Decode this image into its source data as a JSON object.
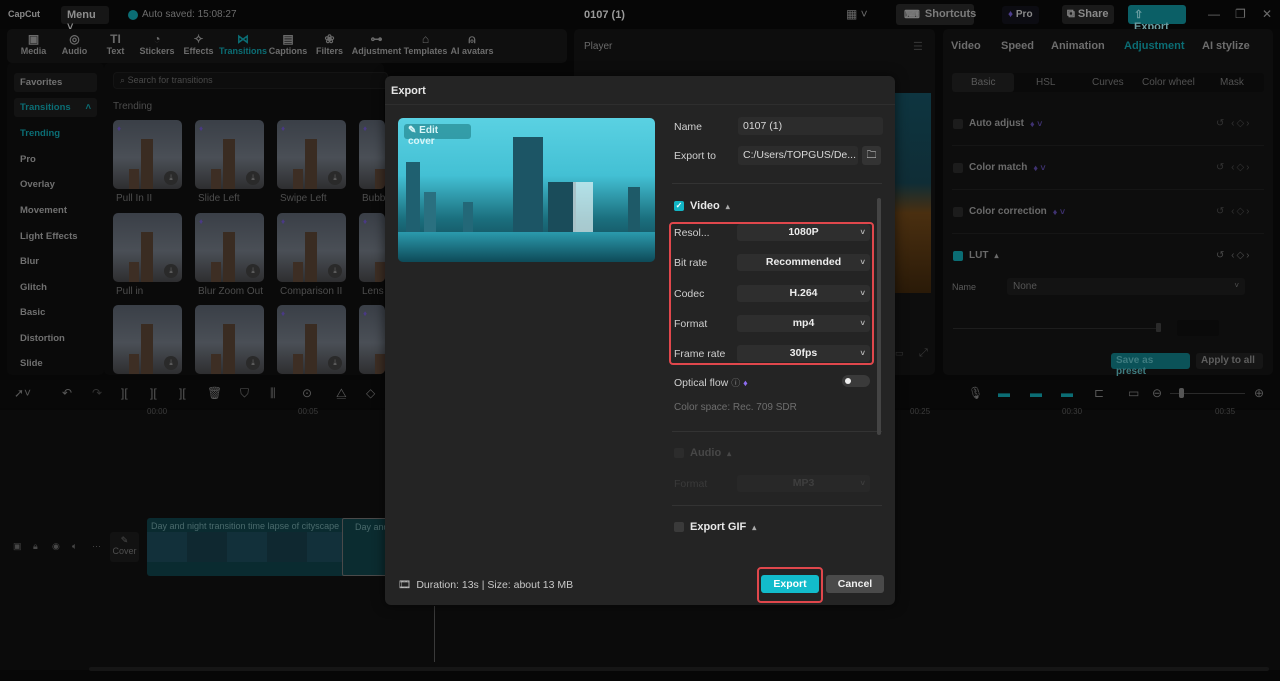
{
  "app": {
    "logo": "CapCut",
    "menu_label": "Menu",
    "autosave": "Auto saved: 15:08:27",
    "project_title": "0107 (1)",
    "shortcuts_label": "Shortcuts",
    "pro_label": "Pro",
    "share_label": "Share",
    "export_label": "Export"
  },
  "toolbar_tabs": [
    {
      "label": "Media",
      "icon": "▣"
    },
    {
      "label": "Audio",
      "icon": "◎"
    },
    {
      "label": "Text",
      "icon": "TI"
    },
    {
      "label": "Stickers",
      "icon": "◔"
    },
    {
      "label": "Effects",
      "icon": "✧"
    },
    {
      "label": "Transitions",
      "icon": "⋈",
      "active": true
    },
    {
      "label": "Captions",
      "icon": "▤"
    },
    {
      "label": "Filters",
      "icon": "❀"
    },
    {
      "label": "Adjustment",
      "icon": "⊶"
    },
    {
      "label": "Templates",
      "icon": "⌂"
    },
    {
      "label": "AI avatars",
      "icon": "⍝"
    }
  ],
  "left_sidebar": {
    "favorites": "Favorites",
    "transitions": "Transitions",
    "categories": [
      "Trending",
      "Pro",
      "Overlay",
      "Movement",
      "Light Effects",
      "Blur",
      "Glitch",
      "Basic",
      "Distortion",
      "Slide"
    ]
  },
  "transitions_panel": {
    "search_placeholder": "Search for transitions",
    "section_title": "Trending",
    "items": [
      {
        "label": "Pull In II",
        "pro": true
      },
      {
        "label": "Slide Left",
        "pro": true
      },
      {
        "label": "Swipe Left",
        "pro": true
      },
      {
        "label": "Bubble",
        "pro": true
      },
      {
        "label": "Pull in",
        "pro": false
      },
      {
        "label": "Blur Zoom Out",
        "pro": true
      },
      {
        "label": "Comparison II",
        "pro": true
      },
      {
        "label": "Lens",
        "pro": true
      },
      {
        "label": "",
        "pro": false
      },
      {
        "label": "",
        "pro": false
      },
      {
        "label": "",
        "pro": true
      },
      {
        "label": "",
        "pro": true
      }
    ]
  },
  "player": {
    "title": "Player"
  },
  "right_panel": {
    "tabs": [
      "Video",
      "Speed",
      "Animation",
      "Adjustment",
      "AI stylize"
    ],
    "active_tab": "Adjustment",
    "subtabs": [
      "Basic",
      "HSL",
      "Curves",
      "Color wheel",
      "Mask"
    ],
    "rows": [
      {
        "label": "Auto adjust",
        "checked": false
      },
      {
        "label": "Color match",
        "checked": false
      },
      {
        "label": "Color correction",
        "checked": false
      },
      {
        "label": "LUT",
        "checked": true
      }
    ],
    "lut_name_label": "Name",
    "lut_name_value": "None",
    "save_preset": "Save as preset",
    "apply_all": "Apply to all"
  },
  "timeline": {
    "ruler": [
      "00:00",
      "00:05",
      "00:25",
      "00:30",
      "00:35"
    ],
    "cover_label": "Cover",
    "clip_label": "Day and night transition time lapse of cityscape",
    "clip2_label": "Day and"
  },
  "export_dialog": {
    "title": "Export",
    "edit_cover": "Edit cover",
    "name_label": "Name",
    "name_value": "0107 (1)",
    "export_to_label": "Export to",
    "export_to_value": "C:/Users/TOPGUS/De...",
    "video_section": "Video",
    "video_checked": true,
    "settings": [
      {
        "label": "Resol...",
        "value": "1080P"
      },
      {
        "label": "Bit rate",
        "value": "Recommended"
      },
      {
        "label": "Codec",
        "value": "H.264"
      },
      {
        "label": "Format",
        "value": "mp4"
      },
      {
        "label": "Frame rate",
        "value": "30fps"
      }
    ],
    "optical_flow_label": "Optical flow",
    "optical_flow_on": false,
    "color_space": "Color space: Rec. 709 SDR",
    "audio_section": "Audio",
    "audio_checked": false,
    "audio_format_label": "Format",
    "audio_format_value": "MP3",
    "gif_section": "Export GIF",
    "gif_checked": false,
    "footer_info": "Duration: 13s | Size: about 13 MB",
    "export_button": "Export",
    "cancel_button": "Cancel"
  },
  "colors": {
    "accent": "#12bccb",
    "highlight": "#e0474c",
    "dim_accent": "#0b6d74"
  }
}
